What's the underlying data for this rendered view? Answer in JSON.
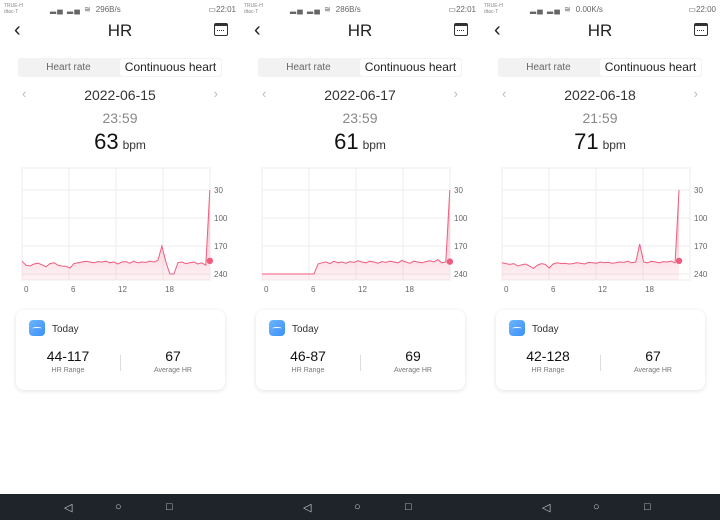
{
  "accent": "#ef5d7e",
  "tabs": [
    "Heart rate",
    "Continuous heart"
  ],
  "title": "HR",
  "y_ticks": [
    "240",
    "170",
    "100",
    "30"
  ],
  "x_ticks": [
    "0",
    "6",
    "12",
    "18"
  ],
  "card": {
    "today": "Today",
    "range_label": "HR Range",
    "avg_label": "Average HR"
  },
  "panels": [
    {
      "status": {
        "carrier": "TRUE-H dtac-T",
        "speed": "296B/s",
        "clock": "22:01"
      },
      "date": "2022-06-15",
      "time": "23:59",
      "bpm": "63",
      "bpm_unit": "bpm",
      "range": "44-117",
      "avg": "67"
    },
    {
      "status": {
        "carrier": "TRUE-H dtac-T",
        "speed": "286B/s",
        "clock": "22:01"
      },
      "date": "2022-06-17",
      "time": "23:59",
      "bpm": "61",
      "bpm_unit": "bpm",
      "range": "46-87",
      "avg": "69"
    },
    {
      "status": {
        "carrier": "TRUE-H dtac-T",
        "speed": "0.00K/s",
        "clock": "22:00"
      },
      "date": "2022-06-18",
      "time": "21:59",
      "bpm": "71",
      "bpm_unit": "bpm",
      "range": "42-128",
      "avg": "67"
    }
  ],
  "chart_data": [
    {
      "type": "area",
      "x_unit": "hour",
      "xlim": [
        0,
        24
      ],
      "ylim": [
        15,
        295
      ],
      "y_ticks": [
        30,
        100,
        170,
        240
      ],
      "x_ticks": [
        0,
        6,
        12,
        18
      ],
      "grid": true,
      "values": [
        62,
        52,
        50,
        55,
        57,
        53,
        48,
        56,
        58,
        52,
        50,
        49,
        45,
        56,
        58,
        60,
        62,
        60,
        58,
        61,
        60,
        62,
        58,
        60,
        55,
        60,
        61,
        57,
        62,
        58,
        60,
        59,
        62,
        60,
        64,
        100,
        60,
        30,
        30,
        58,
        60,
        56,
        58,
        60,
        55,
        58,
        52,
        240
      ],
      "current": 63,
      "current_hour": 23.98
    },
    {
      "type": "area",
      "x_unit": "hour",
      "xlim": [
        0,
        24
      ],
      "ylim": [
        15,
        295
      ],
      "y_ticks": [
        30,
        100,
        170,
        240
      ],
      "x_ticks": [
        0,
        6,
        12,
        18
      ],
      "grid": true,
      "values": [
        30,
        30,
        30,
        30,
        30,
        30,
        30,
        30,
        30,
        30,
        30,
        30,
        30,
        30,
        55,
        58,
        60,
        56,
        62,
        58,
        60,
        57,
        61,
        59,
        63,
        60,
        58,
        62,
        60,
        57,
        61,
        59,
        62,
        60,
        58,
        64,
        60,
        57,
        62,
        60,
        58,
        61,
        63,
        60,
        66,
        58,
        60,
        240
      ],
      "current": 61,
      "current_hour": 23.98
    },
    {
      "type": "area",
      "x_unit": "hour",
      "xlim": [
        0,
        24
      ],
      "ylim": [
        15,
        295
      ],
      "y_ticks": [
        30,
        100,
        170,
        240
      ],
      "x_ticks": [
        0,
        6,
        12,
        18
      ],
      "grid": true,
      "values": [
        58,
        56,
        54,
        56,
        50,
        53,
        55,
        50,
        44,
        52,
        56,
        54,
        45,
        55,
        58,
        56,
        57,
        55,
        56,
        58,
        57,
        55,
        59,
        58,
        57,
        60,
        58,
        59,
        57,
        58,
        60,
        59,
        62,
        58,
        60,
        105,
        60,
        58,
        62,
        60,
        58,
        61,
        60,
        62,
        58,
        240
      ],
      "current": 63,
      "current_hour": 22.6
    }
  ]
}
